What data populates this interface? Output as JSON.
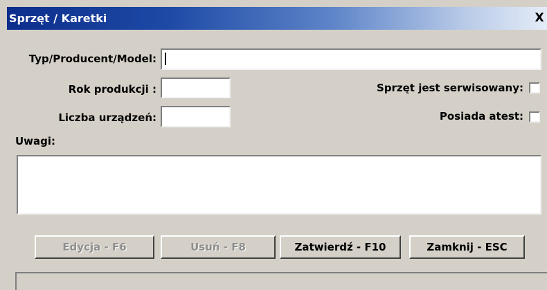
{
  "window": {
    "title": "Sprzęt / Karetki",
    "close_glyph": "X"
  },
  "form": {
    "typ_label": "Typ/Producent/Model:",
    "typ_value": "",
    "rok_label": "Rok produkcji :",
    "rok_value": "",
    "liczba_label": "Liczba urządzeń:",
    "liczba_value": "",
    "serwis_label": "Sprzęt jest serwisowany:",
    "serwis_checked": false,
    "atest_label": "Posiada atest:",
    "atest_checked": false,
    "uwagi_label": "Uwagi:",
    "uwagi_value": ""
  },
  "buttons": {
    "edycja": "Edycja - F6",
    "usun": "Usuń - F8",
    "zatwierdz": "Zatwierdź - F10",
    "zamknij": "Zamknij - ESC"
  },
  "colors": {
    "title_start": "#0c2d8c",
    "title_end": "#e4ecf7",
    "face": "#d4d0c8"
  }
}
